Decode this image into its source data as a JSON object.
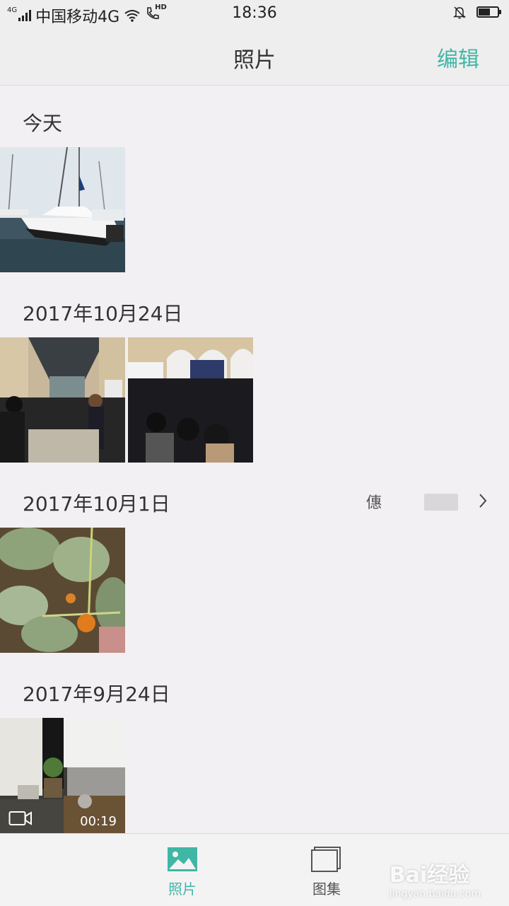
{
  "status_bar": {
    "network_type": "4G",
    "carrier": "中国移动4G",
    "hd_label": "HD",
    "time": "18:36",
    "battery_level": 0.6
  },
  "nav": {
    "title": "照片",
    "edit": "编辑"
  },
  "sections": [
    {
      "date": "今天"
    },
    {
      "date": "2017年10月24日"
    },
    {
      "date": "2017年10月1日",
      "location": "僡"
    },
    {
      "date": "2017年9月24日",
      "video_duration": "00:19"
    }
  ],
  "tabs": [
    {
      "label": "照片",
      "icon": "photos-icon",
      "active": true
    },
    {
      "label": "图集",
      "icon": "albums-icon",
      "active": false
    }
  ],
  "watermark": {
    "brand": "Bai经验",
    "url": "jingyan.baidu.com"
  },
  "colors": {
    "accent": "#3fb7a5",
    "background": "#f2f0f2"
  }
}
